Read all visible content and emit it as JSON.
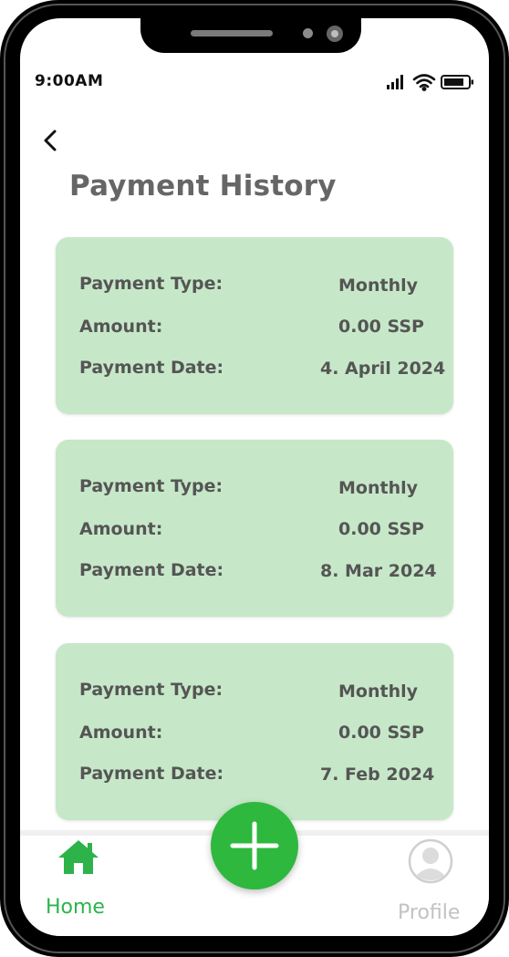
{
  "status_bar": {
    "time": "9:00AM",
    "icons": [
      "signal-icon",
      "wifi-icon",
      "battery-icon"
    ]
  },
  "header": {
    "back_icon": "chevron-left-icon",
    "title": "Payment History"
  },
  "payments": [
    {
      "type_label": "Payment Type:",
      "type_value": "Monthly",
      "amount_label": "Amount:",
      "amount_value": "0.00 SSP",
      "date_label": "Payment Date:",
      "date_value": "4. April 2024"
    },
    {
      "type_label": "Payment Type:",
      "type_value": "Monthly",
      "amount_label": "Amount:",
      "amount_value": "0.00 SSP",
      "date_label": "Payment Date:",
      "date_value": "8. Mar 2024"
    },
    {
      "type_label": "Payment Type:",
      "type_value": "Monthly",
      "amount_label": "Amount:",
      "amount_value": "0.00 SSP",
      "date_label": "Payment Date:",
      "date_value": "7. Feb 2024"
    }
  ],
  "bottom_nav": {
    "home_label": "Home",
    "profile_label": "Profile",
    "add_icon": "plus-icon",
    "active": "Home"
  },
  "colors": {
    "accent": "#2eb83e",
    "card_bg": "#c6e8c8",
    "text": "#555555",
    "inactive": "#c2c2c2"
  }
}
